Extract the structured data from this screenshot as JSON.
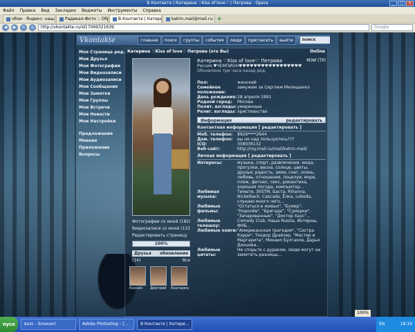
{
  "window": {
    "title": "В Контакте | Катерина ♡Kiss of love♡ | Петрова - Opera",
    "controls": [
      "_",
      "□",
      "×"
    ]
  },
  "menu": [
    "Файл",
    "Правка",
    "Вид",
    "Закладки",
    "Виджеты",
    "Инструменты",
    "Справка"
  ],
  "tabs": [
    {
      "label": "обои - Яндекс: нашлось ...",
      "active": false
    },
    {
      "label": "Радикал-Фото :: Обр...",
      "active": false
    },
    {
      "label": "В Контакте | Катерина ...",
      "active": true
    },
    {
      "label": "katrin.mail@mail.ru: нет...",
      "active": false
    }
  ],
  "address": {
    "url": "http://vkontakte.ru/id17069321639",
    "search_placeholder": "Google"
  },
  "vk": {
    "logo": "Vkontakte",
    "nav": [
      "главная",
      "поиск",
      "группы",
      "события",
      "люди",
      "пригласить",
      "выйти"
    ],
    "search_label": "поиск",
    "left_menu": [
      "Моя Страница",
      "Мои Друзья",
      "Мои Фотографии",
      "Мои Видеозаписи",
      "Мои Аудиозаписи",
      "Мои Сообщения",
      "Мои Заметки",
      "Мои Группы",
      "Мои Встречи",
      "Мои Новости",
      "Мои Настройки"
    ],
    "left_menu_extra": [
      "Предложения",
      "Мнения",
      "Приложения",
      "Вопросы"
    ],
    "left_menu_edit": "ред.",
    "page_title": "Катерина ♡Kiss of love♡ Петрова (это Вы)",
    "online": "Online",
    "profile": {
      "name": "Катерина ♡Kiss of love♡ Петрова",
      "status": "Россия ♥ЧЕМПИОН♥♥♥♥♥♥♥♥♥♥♥♥♥♥♥♥♥",
      "updated": "Обновлено три часа назад ред.",
      "university": "МЭИ (ТУ)",
      "fields": [
        {
          "k": "Пол:",
          "v": "женский"
        },
        {
          "k": "Семейное положение:",
          "v": "замужем за Сергеем Мелещенко"
        },
        {
          "k": "День рождения:",
          "v": "28 апреля 1991"
        },
        {
          "k": "Родной город:",
          "v": "Москва"
        },
        {
          "k": "Полит. взгляды:",
          "v": "умеренные"
        },
        {
          "k": "Религ. взгляды:",
          "v": "христианство"
        }
      ],
      "info_bar": {
        "title": "Информация",
        "action": "редактировать"
      },
      "contact_title": "Контактная информация [ редактировать ]",
      "contacts": [
        {
          "k": "Моб. телефон:",
          "v": "8926****2644"
        },
        {
          "k": "Дом. телефон:",
          "v": "вы не над пользуетесь???"
        },
        {
          "k": "ICQ:",
          "v": "358036132"
        },
        {
          "k": "Веб-сайт:",
          "v": "http://my.mail.ru/mail/katrin.mail/"
        }
      ],
      "personal_title": "Личная информация [ редактировать ]",
      "personal": [
        {
          "k": "Интересы:",
          "v": "музыка, спорт, развлечения, мода, прогулки, весна, солнце, цветы, друзья, радость, зима, снег, осень, любовь, отношения, поцелуи, море, пляж, фитнес, секс, романтика, хорошая погода, компьютер..."
        },
        {
          "k": "Любимая музыка:",
          "v": "Тимати, 30STM, Баста, Rihanna, Nickelback, Cascada, Ёлка, Loboda, слушаю много чего..."
        },
        {
          "k": "Любимые фильмы:",
          "v": "\"Остаться в живых\", \"Бумер\", \"Королёв\", \"Бригада\", \"Сумерки\", \"Зачарованные\", \"Доктор Хаус\"..."
        },
        {
          "k": "Любимые телешоу:",
          "v": "Comedy Club, Наша Russia, Интерны, ФНБ..."
        },
        {
          "k": "Любимые книги:",
          "v": "\"Американская трагедия\", \"Сестра Кэрри\", Теодор Драйзер, \"Мастер и Маргарита\", Михаил Булгаков, Дарья Донцова..."
        },
        {
          "k": "Любимые цитаты:",
          "v": "Не спорьте с дураком, люди могут не заметить разницы..."
        }
      ]
    },
    "photo_links": [
      "Фотографии со мной (182)",
      "Видеозаписи со мной (133)",
      "Редактировать страницу"
    ],
    "progress": {
      "label": "100%",
      "value": 100
    },
    "friends_bar": {
      "title": "Друзья",
      "action": "обновления"
    },
    "friends_count": {
      "left": "(14)",
      "right": "Все"
    },
    "friends": [
      "Ксения",
      "Дмитрий",
      "Екатерина"
    ]
  },
  "taskbar": {
    "start": "пуск",
    "tasks": [
      {
        "label": "вэлс - Блокнот",
        "active": false
      },
      {
        "label": "Adobe Photoshop - [...",
        "active": false
      },
      {
        "label": "В Контакте | Катери...",
        "active": true
      }
    ],
    "zoom": "100%",
    "lang": "EN",
    "time": "18:19"
  },
  "colors": {
    "accent": "#3b5f88",
    "taskbar": "#1f4fb4",
    "start": "#2f8a2f"
  }
}
